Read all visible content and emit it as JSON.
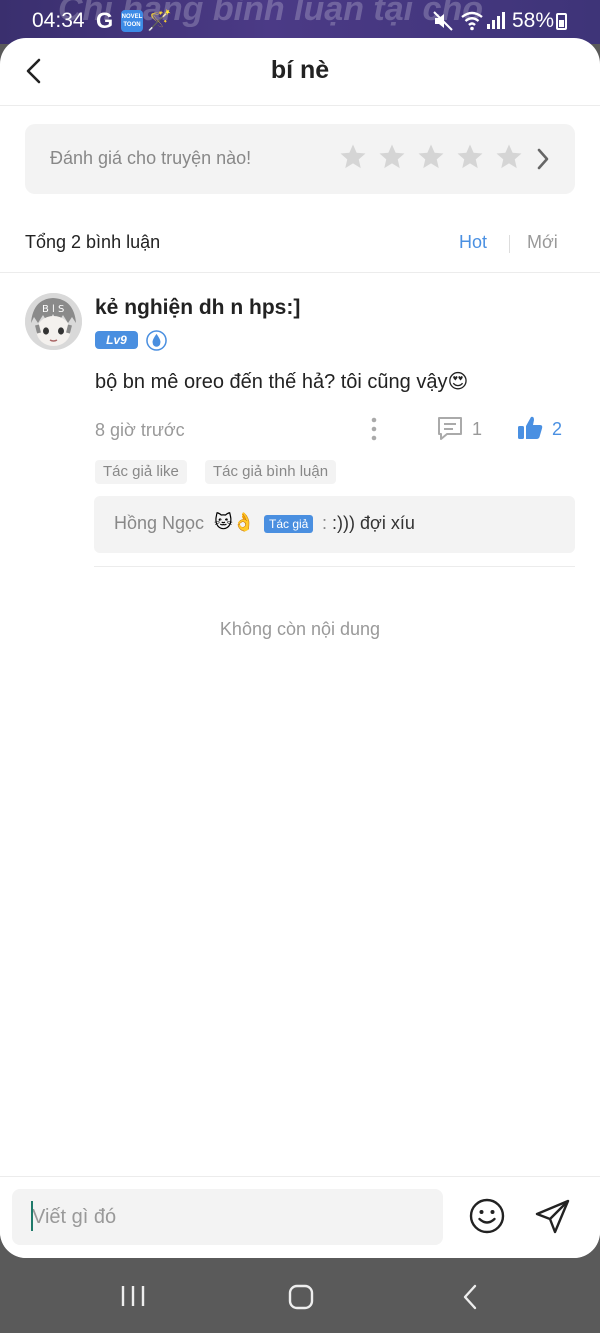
{
  "status_bar": {
    "time": "04:34",
    "g_label": "G",
    "watermark": "Chỉ hàng bình luận tại cho",
    "battery": "58%"
  },
  "header": {
    "title": "bí nè"
  },
  "rating": {
    "prompt": "Đánh giá cho truyện nào!",
    "stars_total": 5,
    "stars_filled": 0,
    "star_color": "#d5d5d5"
  },
  "comments_section": {
    "total": "Tổng 2 bình luận",
    "sort_hot": "Hot",
    "sort_new": "Mới",
    "active_sort_color": "#4a90e2"
  },
  "comment": {
    "username": "kẻ nghiện dh n hps:]",
    "level": "Lv9",
    "body": "bộ bn mê oreo đến thế hả? tôi cũng vậy😍",
    "time": "8 giờ trước",
    "reply_count": "1",
    "like_count": "2",
    "tags": [
      "Tác giả like",
      "Tác giả bình luận"
    ],
    "reply": {
      "author": "Hồng Ngọc",
      "author_emoji": "🐱👌",
      "author_badge": "Tác giả",
      "text": ":))) đợi xíu"
    }
  },
  "end_of_list": "Không còn nội dung",
  "input": {
    "placeholder": "Viết gì đó"
  },
  "icons": {
    "back": "chevron-left-icon",
    "emoji": "smiley-icon",
    "send": "paper-plane-icon",
    "reply": "chat-bubble-icon",
    "like": "thumbs-up-icon",
    "more": "vertical-dots-icon"
  }
}
